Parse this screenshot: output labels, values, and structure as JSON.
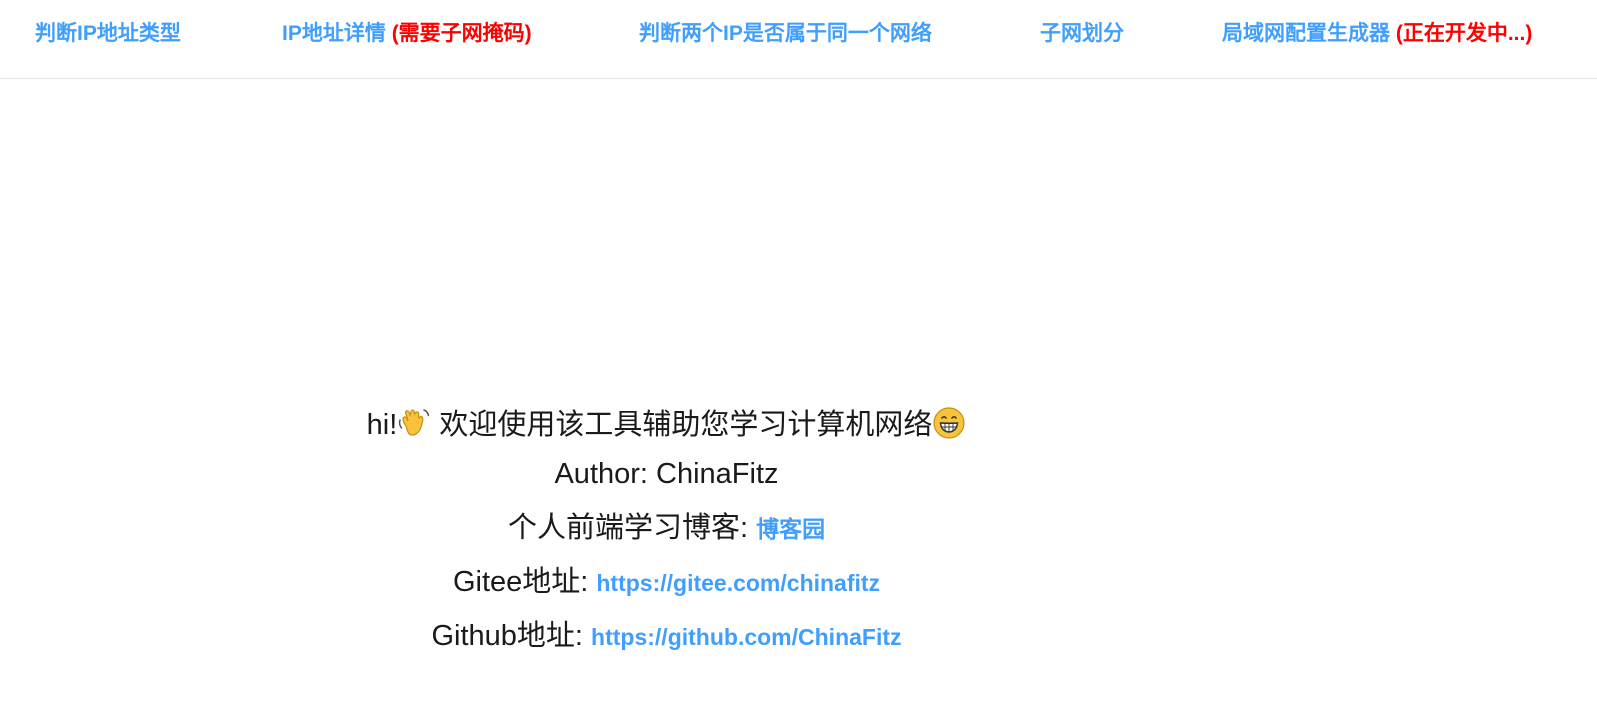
{
  "nav": {
    "items": [
      {
        "label": "判断IP地址类型",
        "note": ""
      },
      {
        "label": "IP地址详情",
        "note": "(需要子网掩码)"
      },
      {
        "label": "判断两个IP是否属于同一个网络",
        "note": ""
      },
      {
        "label": "子网划分",
        "note": ""
      },
      {
        "label": "局域网配置生成器",
        "note": "(正在开发中...)"
      }
    ],
    "colors": {
      "link": "#409eff",
      "warning": "#ff0000"
    }
  },
  "intro": {
    "greeting_prefix": "hi!",
    "greeting_icon": "waving-hand-icon",
    "welcome_text": "欢迎使用该工具辅助您学习计算机网络",
    "welcome_icon": "grinning-face-icon",
    "author_label": "Author:",
    "author_name": "ChinaFitz",
    "blog_label": "个人前端学习博客:",
    "blog_link": "博客园",
    "gitee_label": "Gitee地址:",
    "gitee_link": "https://gitee.com/chinafitz",
    "github_label": "Github地址:",
    "github_link": "https://github.com/ChinaFitz"
  }
}
